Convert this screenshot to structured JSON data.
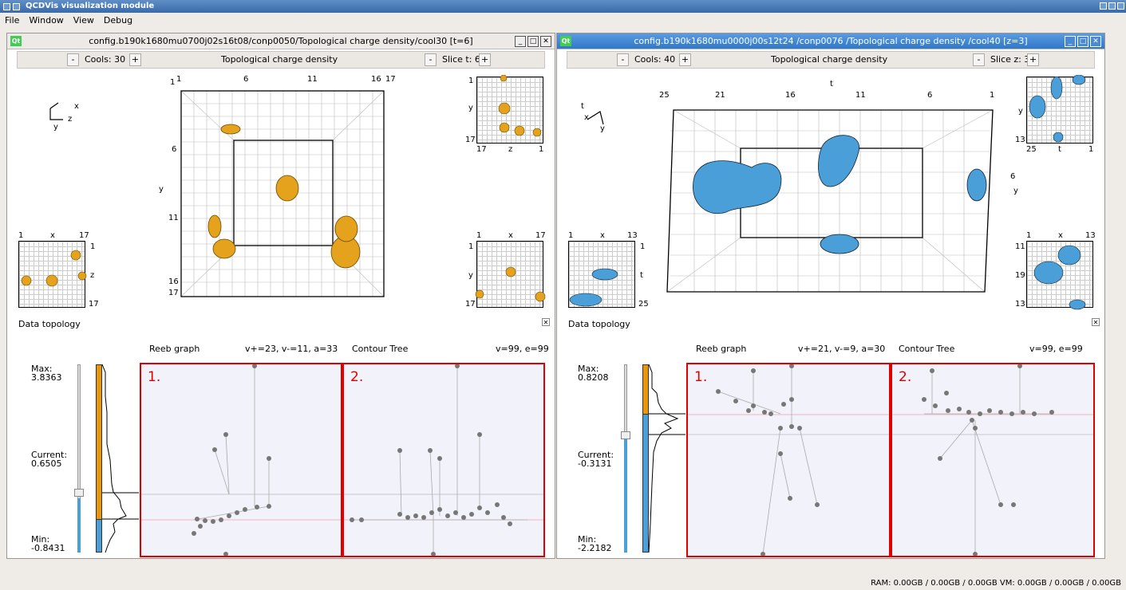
{
  "app": {
    "title": "QCDVis visualization module"
  },
  "menu": [
    "File",
    "Window",
    "View",
    "Debug"
  ],
  "left": {
    "title": "config.b190k1680mu0700j02s16t08/conp0050/Topological charge density/cool30 [t=6]",
    "cools_label": "Cools: 30",
    "field": "Topological charge density",
    "slice_label": "Slice t: 6",
    "minus": "-",
    "plus": "+",
    "axes": {
      "x": "x",
      "y": "y",
      "z": "z"
    },
    "top_ticks": [
      "1",
      "1",
      "6",
      "11",
      "16",
      "17"
    ],
    "left_ticks": [
      "1",
      "6",
      "11",
      "16",
      "17"
    ],
    "ylabel": "y",
    "mini_tr": {
      "top": "1",
      "y": "y",
      "mid": "17",
      "bl": "17",
      "bx": "z",
      "br": "1"
    },
    "mini_bl": {
      "a": "1",
      "x": "x",
      "b": "17",
      "r1": "1",
      "rz": "z",
      "r2": "17"
    },
    "mini_br": {
      "a": "1",
      "x": "x",
      "b": "17",
      "r1": "1",
      "ry": "y",
      "r2": "17"
    },
    "topo_label": "Data topology",
    "reeb": "Reeb graph",
    "reeb_stats": "v+=23, v-=11, a=33",
    "ct": "Contour Tree",
    "ct_stats": "v=99, e=99",
    "max_label": "Max:",
    "max": "3.8363",
    "current_label": "Current:",
    "current": "0.6505",
    "min_label": "Min:",
    "min": "-0.8431",
    "p1": "1.",
    "p2": "2.",
    "accent": "#e8960a"
  },
  "right": {
    "title": "config.b190k1680mu0000j00s12t24 /conp0076 /Topological charge density /cool40 [z=3]",
    "cools_label": "Cools: 40",
    "field": "Topological charge density",
    "slice_label": "Slice z: 3",
    "minus": "-",
    "plus": "+",
    "axes": {
      "t": "t",
      "x": "x",
      "y": "y"
    },
    "top_axis": "t",
    "top_ticks": [
      "25",
      "21",
      "16",
      "11",
      "6",
      "1",
      "1"
    ],
    "side_ticks": [
      "6"
    ],
    "ylabel": "y",
    "mini_tr": {
      "y": "y",
      "mid": "13",
      "bl": "25",
      "bt": "t",
      "br": "1"
    },
    "mini_bl": {
      "a": "1",
      "x": "x",
      "b": "13",
      "r1": "1",
      "rt": "t",
      "r2": "25"
    },
    "mini_br": {
      "a": "1",
      "x": "x",
      "b": "13",
      "r1": "11",
      "ry": "19",
      "r2": "13"
    },
    "topo_label": "Data topology",
    "reeb": "Reeb graph",
    "reeb_stats": "v+=21, v-=9, a=30",
    "ct": "Contour Tree",
    "ct_stats": "v=99, e=99",
    "max_label": "Max:",
    "max": "0.8208",
    "current_label": "Current:",
    "current": "-0.3131",
    "min_label": "Min:",
    "min": "-2.2182",
    "p1": "1.",
    "p2": "2.",
    "accent": "#4a9fd8"
  },
  "status": "RAM: 0.00GB / 0.00GB / 0.00GB  VM: 0.00GB / 0.00GB / 0.00GB",
  "qt_badge": "Qt"
}
